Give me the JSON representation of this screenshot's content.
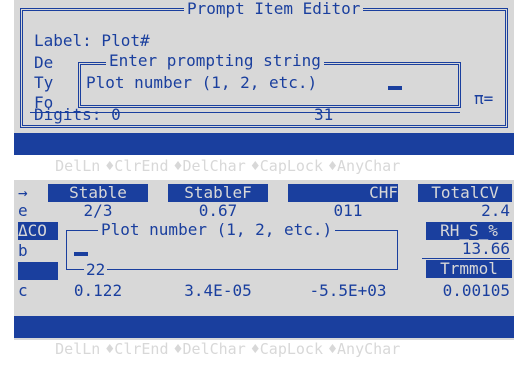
{
  "screen1": {
    "title": "Prompt Item Editor",
    "label_line": "Label: Plot#",
    "behind_de": "De",
    "behind_ty": "Ty",
    "behind_fo": "Fo",
    "dialog_title": "Enter prompting string",
    "input_value": "Plot number (1, 2, etc.)",
    "digits_label": "Digits: 0",
    "digits_value": "31",
    "right_label": "π=",
    "menu": [
      "DelLn",
      "♦ClrEnd",
      "♦DelChar",
      "♦CapLock",
      "♦AnyChar"
    ]
  },
  "screen2": {
    "arrow": "→",
    "headers": [
      "Stable",
      "StableF",
      "CHF",
      "TotalCV"
    ],
    "row_e": {
      "label": "e",
      "values": [
        "2/3",
        "0.67",
        "011",
        "2.4"
      ]
    },
    "delta_label": "ΔCO",
    "row_b": "b",
    "prompt_title": "Plot number (1, 2, etc.)",
    "prompt_count": "22",
    "right_header": "RH_S_%",
    "right_value": "13.66",
    "right_header2": "Trmmol",
    "row_c": {
      "label": "c",
      "values": [
        "0.122",
        "3.4E-05",
        "-5.5E+03",
        "0.00105"
      ]
    },
    "menu": [
      "DelLn",
      "♦ClrEnd",
      "♦DelChar",
      "♦CapLock",
      "♦AnyChar"
    ]
  }
}
